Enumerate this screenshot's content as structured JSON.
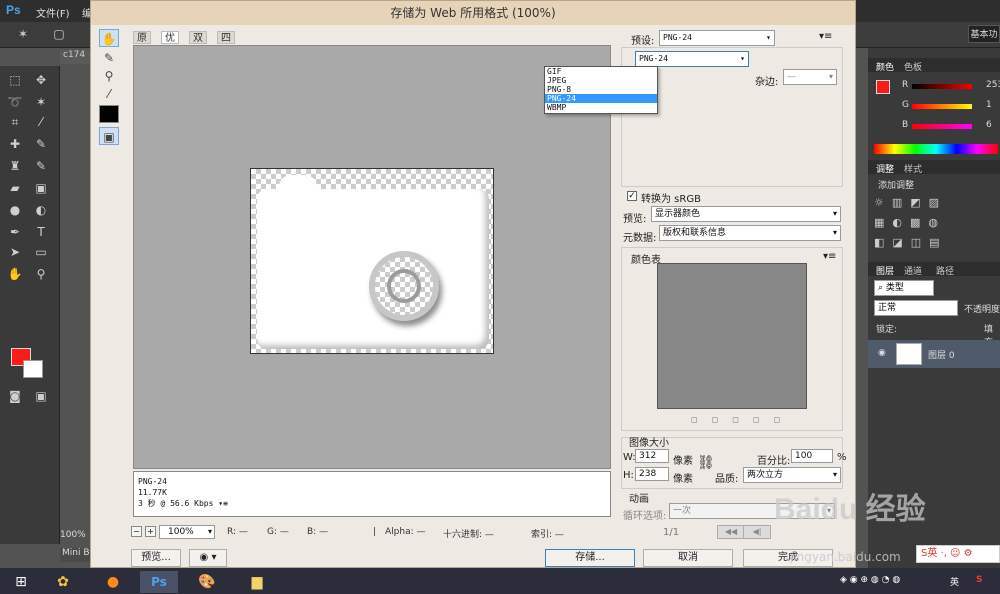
{
  "ps": {
    "logo": "Ps",
    "menu_file": "文件(F)",
    "menu_edit": "编",
    "doc_tab": "c174",
    "zoom_status": "100%",
    "mini_bridge": "Mini B",
    "basic_label": "基本功"
  },
  "right_panels": {
    "color_tab": "颜色",
    "swatch_tab": "色板",
    "r_label": "R",
    "r_value": "253",
    "g_label": "G",
    "g_value": "1",
    "b_label": "B",
    "b_value": "6",
    "adjust_tab": "调整",
    "style_tab": "样式",
    "add_adjust": "添加调整",
    "layers_tab": "图层",
    "channels_tab": "通道",
    "paths_tab": "路径",
    "kind_label": "类型",
    "blend_mode": "正常",
    "opacity_label": "不透明度",
    "lock_label": "锁定:",
    "fill_label": "填充",
    "layer_name": "图层 0"
  },
  "dialog": {
    "title": "存储为 Web 所用格式 (100%)",
    "tabs": [
      "原稿",
      "优化",
      "双联",
      "四联"
    ],
    "active_tab": 1,
    "info_format": "PNG-24",
    "info_size": "11.77K",
    "info_time": "3 秒 @ 56.6 Kbps",
    "info_menu": "▾≡",
    "zoom_value": "100%",
    "r_readout": "R: —",
    "g_readout": "G: —",
    "b_readout": "B: —",
    "alpha_readout": "Alpha: —",
    "hex_readout": "十六进制: —",
    "index_readout": "索引: —",
    "preview_button": "预览...",
    "save_button": "存储...",
    "cancel_button": "取消",
    "done_button": "完成"
  },
  "settings": {
    "preset_label": "预设:",
    "preset_value": "PNG-24",
    "format_value": "PNG-24",
    "format_options": [
      "GIF",
      "JPEG",
      "PNG-8",
      "PNG-24",
      "WBMP"
    ],
    "format_selected": 3,
    "matte_label": "杂边:",
    "matte_value": "—",
    "convert_label": "转换为 sRGB",
    "preview_label": "预览:",
    "preview_value": "显示器颜色",
    "metadata_label": "元数据:",
    "metadata_value": "版权和联系信息",
    "color_table_label": "颜色表",
    "image_size_label": "图像大小",
    "w_label": "W:",
    "w_value": "312",
    "h_label": "H:",
    "h_value": "238",
    "px_unit": "像素",
    "percent_label": "百分比:",
    "percent_value": "100",
    "percent_unit": "%",
    "quality_label": "品质:",
    "quality_value": "两次立方",
    "anim_label": "动画",
    "loop_label": "循环选项:",
    "loop_value": "一次",
    "frame_counter": "1/1"
  },
  "watermark": {
    "brand": "Baidu 经验",
    "url": "jingyan.baidu.com"
  },
  "ime": {
    "label": "S英 ·, ☺ ⚙"
  },
  "taskbar": {
    "lang": "英",
    "colors": {
      "photoshop_blue": "#4aa3e8",
      "fg_red": "#ff1a1a"
    }
  }
}
